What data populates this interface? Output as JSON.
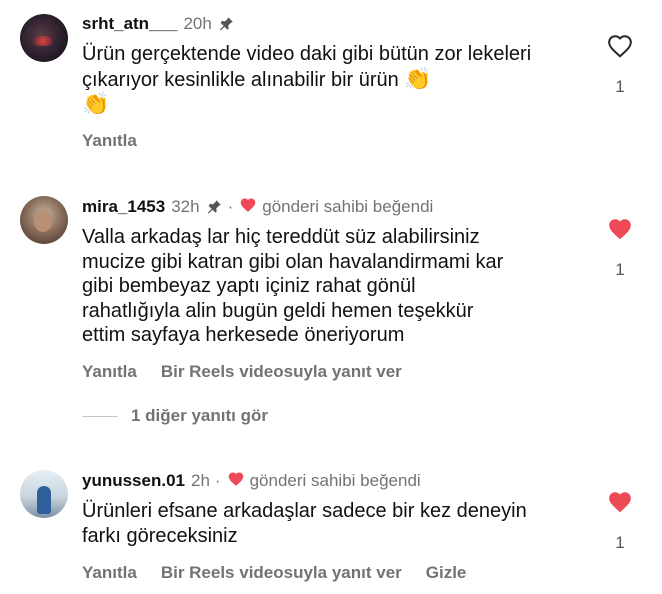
{
  "comments": [
    {
      "username": "srht_atn___",
      "time": "20h",
      "text": "Ürün gerçektende  video daki gibi bütün zor lekeleri çıkarıyor kesinlikle alınabilir bir ürün ",
      "emoji": "👏",
      "emoji2": "👏",
      "likes": "1",
      "liked": false,
      "reply_label": "Yanıtla",
      "avatar_icon": "user-avatar-night-scene"
    },
    {
      "username": "mira_1453",
      "time": "32h",
      "creator_liked": "gönderi sahibi beğendi",
      "text_lines": [
        "Valla arkadaş lar hiç tereddüt süz  alabilirsiniz",
        "mucize gibi katran gibi olan havalandirmami kar",
        "gibi bembeyaz  yaptı içiniz rahat gönül",
        "rahatlığıyla  alin bugün geldi hemen teşekkür",
        "ettim sayfaya herkesede öneriyorum"
      ],
      "likes": "1",
      "liked": true,
      "reply_label": "Yanıtla",
      "reels_label": "Bir Reels videosuyla yanıt ver",
      "view_replies": "1 diğer yanıtı gör",
      "avatar_icon": "user-avatar-portrait"
    },
    {
      "username": "yunussen.01",
      "time": "2h",
      "separator": "·",
      "creator_liked": "gönderi sahibi beğendi",
      "text_lines": [
        "Ürünleri efsane arkadaşlar sadece bir kez deneyin",
        "farkı göreceksiniz"
      ],
      "likes": "1",
      "liked": true,
      "reply_label": "Yanıtla",
      "reels_label": "Bir Reels videosuyla yanıt ver",
      "hide_label": "Gizle",
      "avatar_icon": "user-avatar-outdoor"
    }
  ],
  "colors": {
    "heart_red": "#ed4956",
    "muted": "#737373",
    "text": "#111111"
  }
}
